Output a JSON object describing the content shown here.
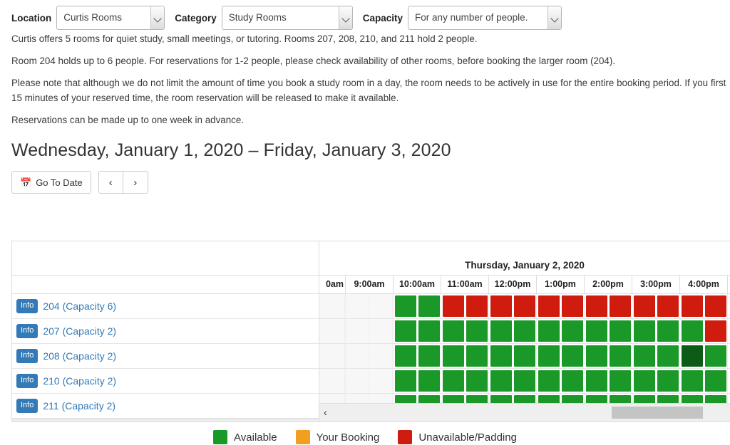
{
  "filters": [
    {
      "label": "Location",
      "value": "Curtis Rooms",
      "name": "location"
    },
    {
      "label": "Category",
      "value": "Study Rooms",
      "name": "category"
    },
    {
      "label": "Capacity",
      "value": "For any number of people.",
      "name": "capacity"
    }
  ],
  "blurb": {
    "p1": "Curtis offers 5 rooms for quiet study, small meetings, or tutoring. Rooms 207, 208, 210, and 211 hold 2 people.",
    "p2": "Room 204 holds  up to 6 people. For reservations for 1-2 people, please check availability of other rooms, before booking the larger room (204).",
    "p3": "Please note that although we do not limit the amount of time you book a study room in a day, the room needs to be actively in use for the entire booking period. If you first 15 minutes of your reserved time, the room reservation will be released to make it available.",
    "p4": "Reservations can be made up to one week in advance."
  },
  "date_heading": "Wednesday, January 1, 2020 – Friday, January 3, 2020",
  "toolbar": {
    "go_to_date_label": "Go To Date",
    "calendar_icon": "📅",
    "prev_label": "‹",
    "next_label": "›"
  },
  "calendar": {
    "day_header": "Thursday, January 2, 2020",
    "time_columns": [
      "0am",
      "9:00am",
      "10:00am",
      "11:00am",
      "12:00pm",
      "1:00pm",
      "2:00pm",
      "3:00pm",
      "4:00pm"
    ],
    "info_badge_label": "Info",
    "rooms": [
      {
        "label": "204 (Capacity 6)",
        "slots": [
          "empty",
          "empty",
          "empty",
          "avail",
          "avail",
          "unavail",
          "unavail",
          "unavail",
          "unavail",
          "unavail",
          "unavail",
          "unavail",
          "unavail",
          "unavail",
          "unavail",
          "unavail",
          "unavail",
          "unavail",
          "unavail",
          "unavail",
          "unavail"
        ]
      },
      {
        "label": "207 (Capacity 2)",
        "slots": [
          "empty",
          "empty",
          "empty",
          "avail",
          "avail",
          "avail",
          "avail",
          "avail",
          "avail",
          "avail",
          "avail",
          "avail",
          "avail",
          "avail",
          "avail",
          "avail",
          "unavail",
          "unavail",
          "unavail",
          "avail",
          "avail"
        ]
      },
      {
        "label": "208 (Capacity 2)",
        "slots": [
          "empty",
          "empty",
          "empty",
          "avail",
          "avail",
          "avail",
          "avail",
          "avail",
          "avail",
          "avail",
          "avail",
          "avail",
          "avail",
          "avail",
          "avail",
          "avail-hover",
          "avail",
          "avail",
          "avail",
          "avail",
          "avail"
        ]
      },
      {
        "label": "210 (Capacity 2)",
        "slots": [
          "empty",
          "empty",
          "empty",
          "avail",
          "avail",
          "avail",
          "avail",
          "avail",
          "avail",
          "avail",
          "avail",
          "avail",
          "avail",
          "avail",
          "avail",
          "avail",
          "avail",
          "unavail",
          "unavail",
          "avail",
          "avail"
        ]
      },
      {
        "label": "211 (Capacity 2)",
        "slots": [
          "empty",
          "empty",
          "empty",
          "avail",
          "avail",
          "avail",
          "avail",
          "avail",
          "avail",
          "avail",
          "avail",
          "avail",
          "avail",
          "avail",
          "avail",
          "avail",
          "avail",
          "avail",
          "avail",
          "avail",
          "avail"
        ]
      }
    ],
    "scrollbar": {
      "left_arrow": "‹"
    }
  },
  "legend": [
    {
      "label": "Available",
      "color": "#1a9928"
    },
    {
      "label": "Your Booking",
      "color": "#f0a01e"
    },
    {
      "label": "Unavailable/Padding",
      "color": "#d01b0f"
    }
  ]
}
